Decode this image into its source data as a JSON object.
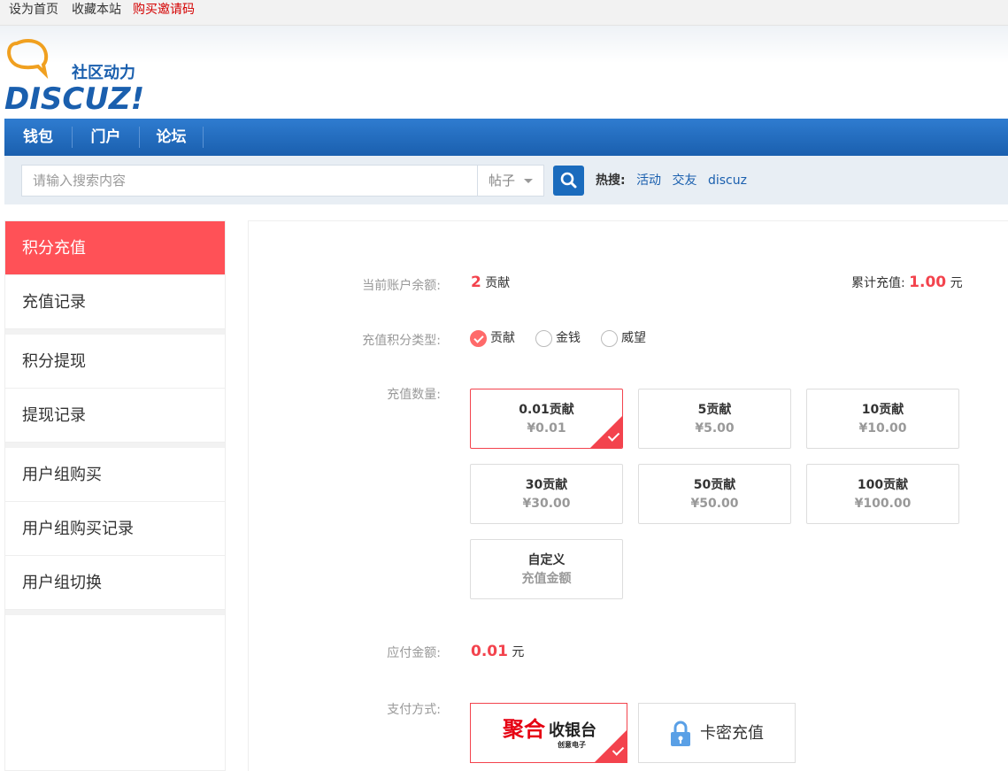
{
  "topbar": {
    "set_home": "设为首页",
    "bookmark": "收藏本站",
    "buy_invite": "购买邀请码"
  },
  "logo": {
    "tagline": "社区动力",
    "brand": "DISCUZ!"
  },
  "nav": {
    "items": [
      "钱包",
      "门户",
      "论坛"
    ]
  },
  "search": {
    "placeholder": "请输入搜索内容",
    "type_selected": "帖子",
    "hot_label": "热搜:",
    "hot_terms": [
      "活动",
      "交友",
      "discuz"
    ]
  },
  "sidebar": {
    "items": [
      "积分充值",
      "充值记录",
      "积分提现",
      "提现记录",
      "用户组购买",
      "用户组购买记录",
      "用户组切换"
    ],
    "active_index": 0
  },
  "recharge": {
    "balance_label": "当前账户余额:",
    "balance_value": "2",
    "balance_unit": "贡献",
    "total_label": "累计充值:",
    "total_value": "1.00",
    "total_unit": "元",
    "type_label": "充值积分类型:",
    "types": [
      "贡献",
      "金钱",
      "威望"
    ],
    "type_selected_index": 0,
    "amount_label": "充值数量:",
    "options": [
      {
        "title": "0.01贡献",
        "price": "¥0.01"
      },
      {
        "title": "5贡献",
        "price": "¥5.00"
      },
      {
        "title": "10贡献",
        "price": "¥10.00"
      },
      {
        "title": "30贡献",
        "price": "¥30.00"
      },
      {
        "title": "50贡献",
        "price": "¥50.00"
      },
      {
        "title": "100贡献",
        "price": "¥100.00"
      },
      {
        "title": "自定义",
        "price": "充值金额"
      }
    ],
    "option_selected_index": 0,
    "payable_label": "应付金额:",
    "payable_value": "0.01",
    "payable_unit": "元",
    "pay_method_label": "支付方式:",
    "pay_methods": [
      {
        "main": "聚合",
        "sub": "收银台",
        "small": "创意电子"
      },
      {
        "main": "卡密充值"
      }
    ],
    "pay_selected_index": 0
  },
  "colors": {
    "accent": "#f3434d",
    "nav": "#1a5fae",
    "sidebar_active": "#ff5157"
  }
}
